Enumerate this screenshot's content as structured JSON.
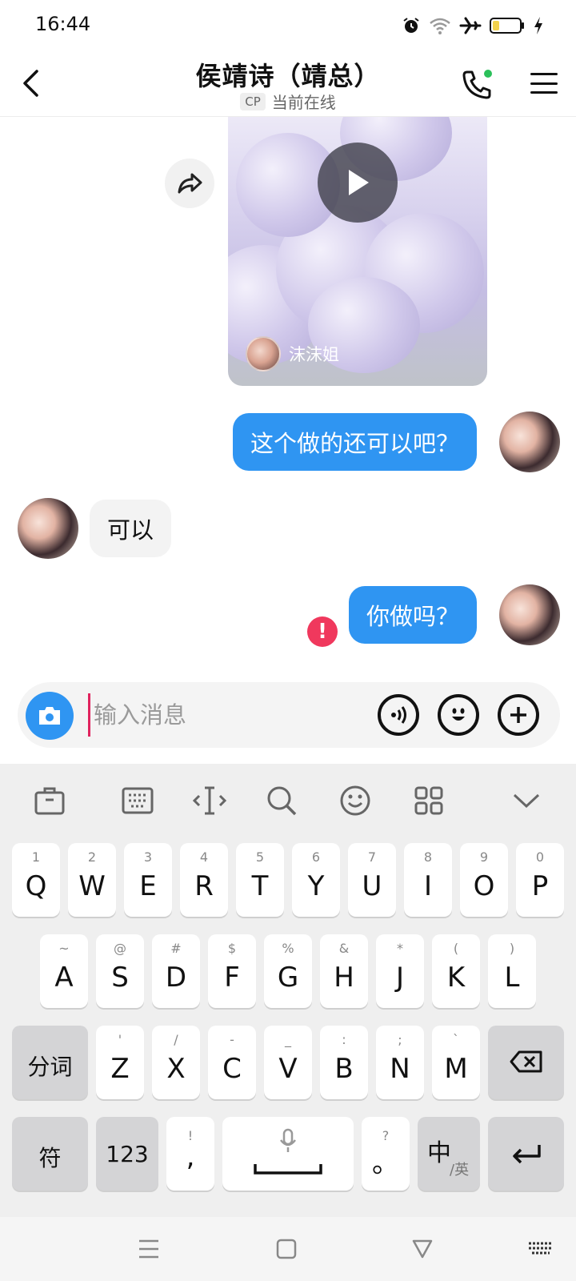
{
  "status_bar": {
    "time": "16:44"
  },
  "header": {
    "title": "侯靖诗（靖总）",
    "badge": "CP",
    "status": "当前在线"
  },
  "video_card": {
    "author": "沫沫姐"
  },
  "messages": [
    {
      "direction": "out",
      "text": "这个做的还可以吧？"
    },
    {
      "direction": "in",
      "text": "可以"
    },
    {
      "direction": "out",
      "text": "你做吗？",
      "error": "!"
    }
  ],
  "composer": {
    "placeholder": "输入消息",
    "value": ""
  },
  "keyboard": {
    "row1": [
      {
        "hint": "1",
        "key": "Q"
      },
      {
        "hint": "2",
        "key": "W"
      },
      {
        "hint": "3",
        "key": "E"
      },
      {
        "hint": "4",
        "key": "R"
      },
      {
        "hint": "5",
        "key": "T"
      },
      {
        "hint": "6",
        "key": "Y"
      },
      {
        "hint": "7",
        "key": "U"
      },
      {
        "hint": "8",
        "key": "I"
      },
      {
        "hint": "9",
        "key": "O"
      },
      {
        "hint": "0",
        "key": "P"
      }
    ],
    "row2": [
      {
        "hint": "~",
        "key": "A"
      },
      {
        "hint": "@",
        "key": "S"
      },
      {
        "hint": "#",
        "key": "D"
      },
      {
        "hint": "$",
        "key": "F"
      },
      {
        "hint": "%",
        "key": "G"
      },
      {
        "hint": "&",
        "key": "H"
      },
      {
        "hint": "*",
        "key": "J"
      },
      {
        "hint": "(",
        "key": "K"
      },
      {
        "hint": ")",
        "key": "L"
      }
    ],
    "row3": [
      {
        "hint": "'",
        "key": "Z"
      },
      {
        "hint": "/",
        "key": "X"
      },
      {
        "hint": "-",
        "key": "C"
      },
      {
        "hint": "_",
        "key": "V"
      },
      {
        "hint": ":",
        "key": "B"
      },
      {
        "hint": ";",
        "key": "N"
      },
      {
        "hint": "`",
        "key": "M"
      }
    ],
    "segment_key": "分词",
    "symbol_key": "符",
    "number_key": "123",
    "comma_hint": "!",
    "comma_key": ",",
    "period_hint": "?",
    "period_key": "。",
    "lang_main": "中",
    "lang_sub": "/英"
  },
  "colors": {
    "accent": "#2f95f2",
    "error": "#f0385d",
    "online_dot": "#2bc05a"
  }
}
